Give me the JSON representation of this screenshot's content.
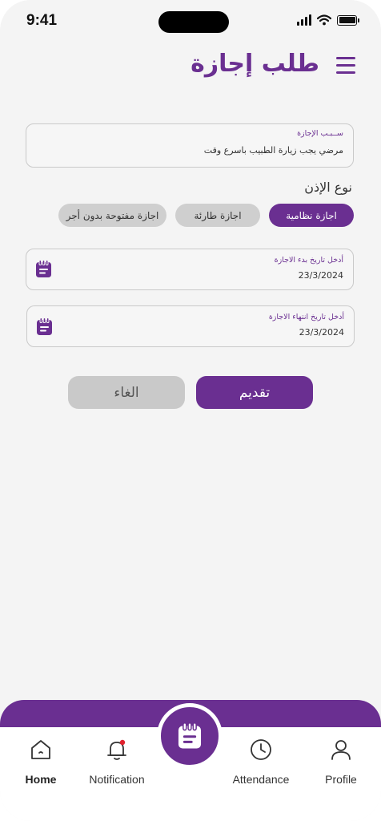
{
  "status_bar": {
    "time": "9:41"
  },
  "header": {
    "title": "طلب إجازة",
    "menu_icon": "hamburger-menu-icon"
  },
  "reason_field": {
    "label": "ســبـب الإجازة",
    "value": "مرضي يجب زيارة الطبيب باسرع وقت"
  },
  "leave_type": {
    "title": "نوع الإذن",
    "options": [
      {
        "label": "اجازة نظامية",
        "selected": true
      },
      {
        "label": "اجازة طارئة",
        "selected": false
      },
      {
        "label": "اجازة مفتوحة بدون أجر",
        "selected": false
      }
    ]
  },
  "start_date": {
    "label": "أدخل تاريخ بدء الاجازة",
    "value": "23/3/2024",
    "icon": "calendar-icon"
  },
  "end_date": {
    "label": "أدخل تاريخ انتهاء الاجازة",
    "value": "23/3/2024",
    "icon": "calendar-icon"
  },
  "actions": {
    "submit_label": "تقديم",
    "cancel_label": "الغاء"
  },
  "bottom_nav": {
    "items": [
      {
        "label": "Home",
        "icon": "home-icon",
        "selected": true
      },
      {
        "label": "Notification",
        "icon": "bell-icon",
        "badge": true
      },
      {
        "label": "Attendance",
        "icon": "clock-icon"
      },
      {
        "label": "Profile",
        "icon": "user-icon"
      }
    ],
    "center_icon": "clipboard-icon"
  },
  "colors": {
    "primary": "#6a2f91",
    "background": "#f4f4f4",
    "chip_inactive": "#cfcfcf",
    "cancel": "#c9c9c9",
    "badge": "#e0222e"
  }
}
